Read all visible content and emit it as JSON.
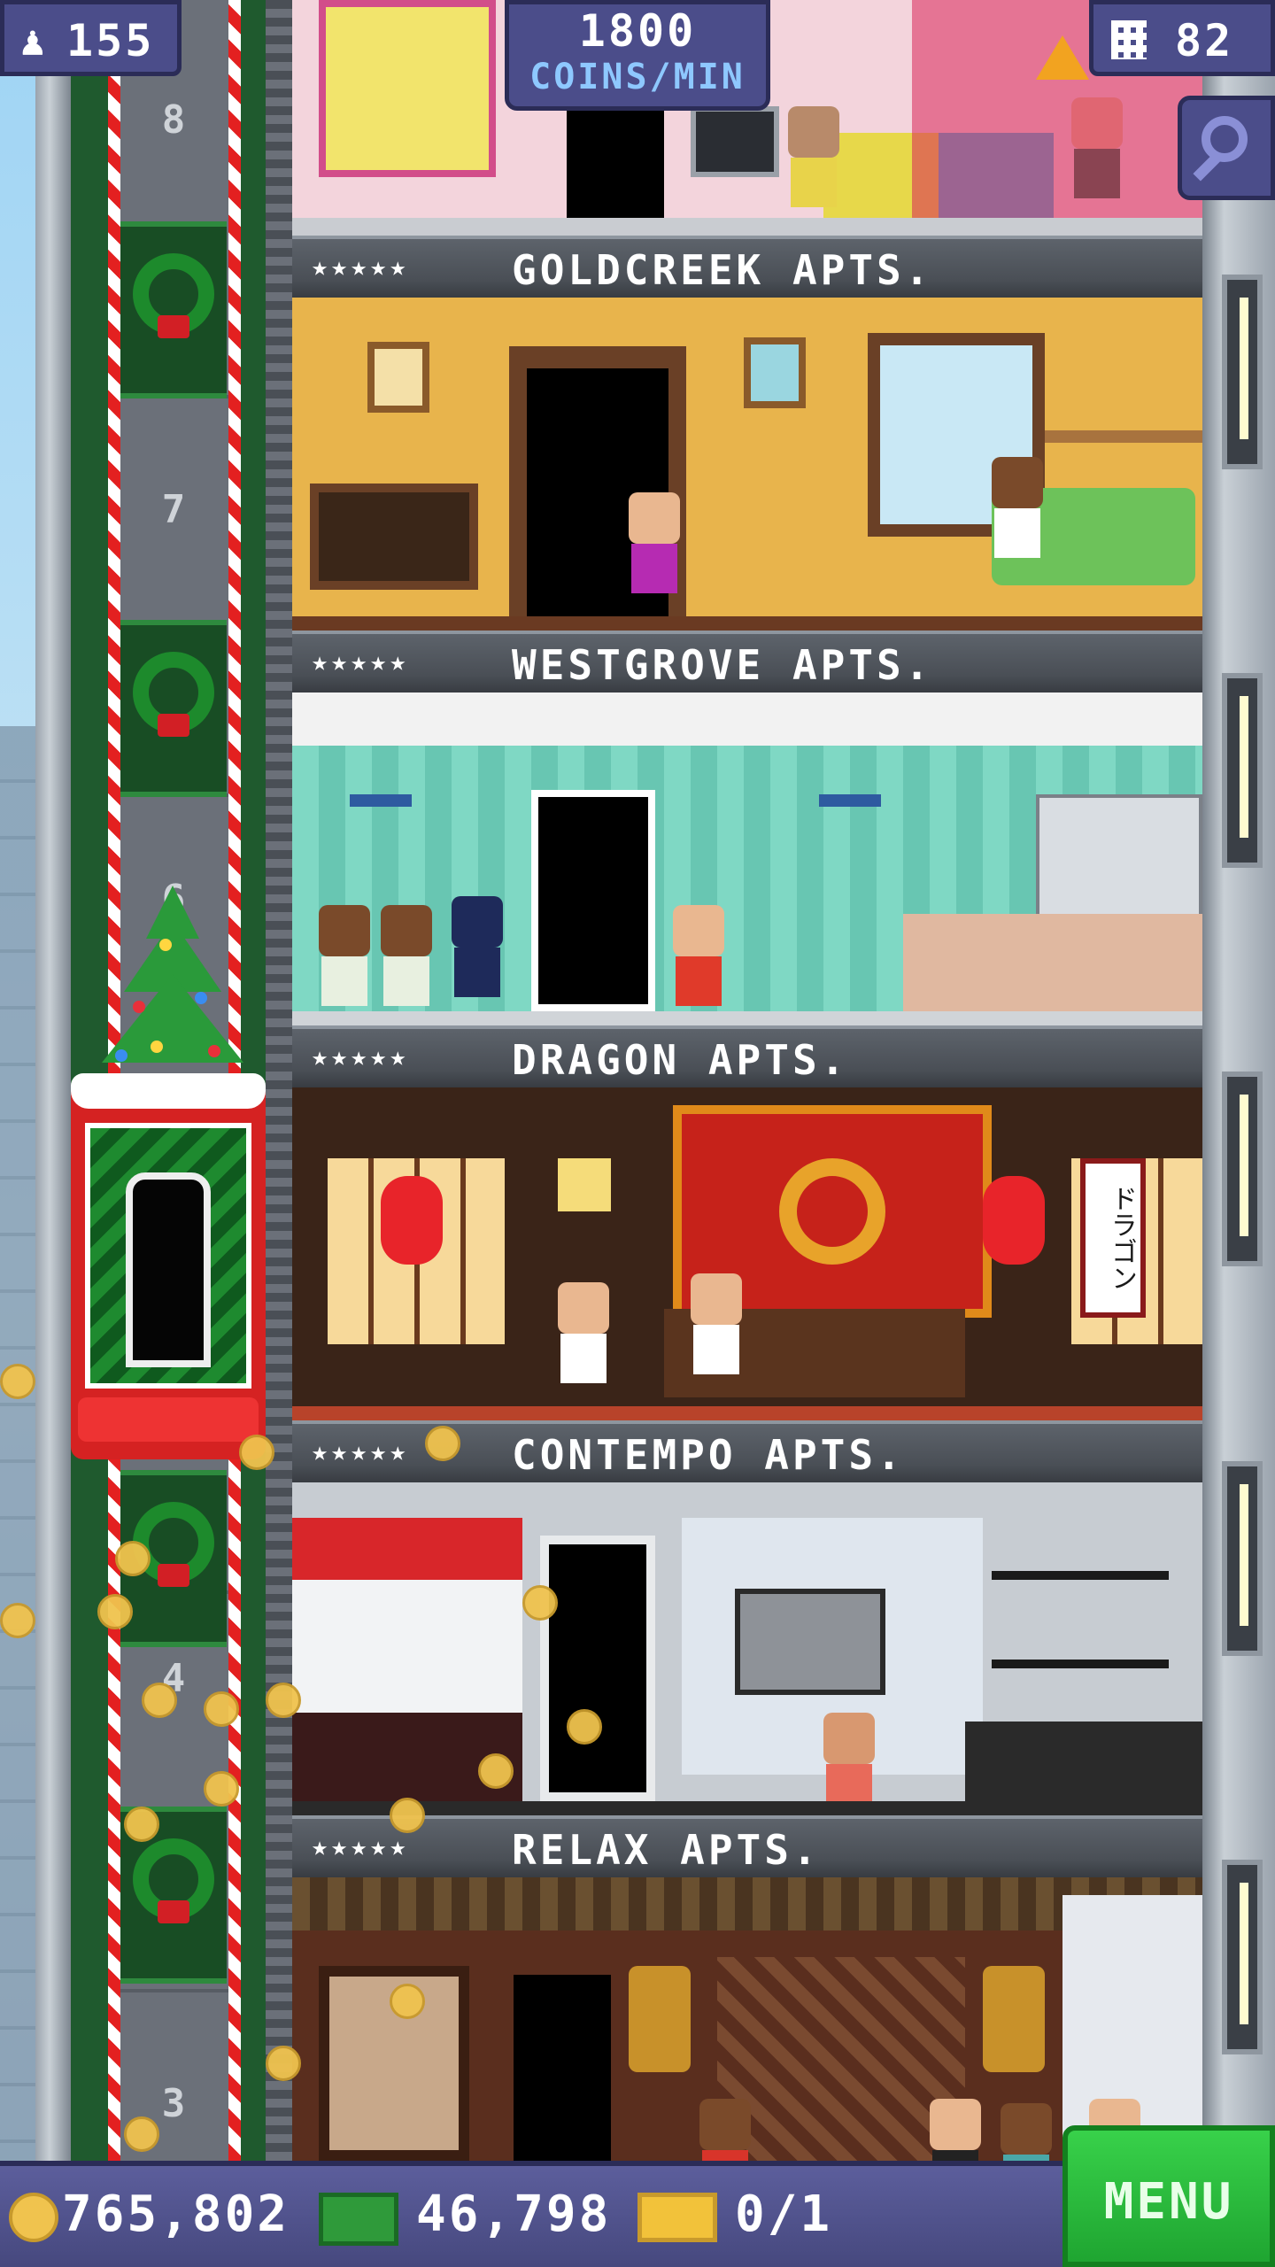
{
  "hud": {
    "population": "155",
    "coins_rate_value": "1800",
    "coins_rate_unit": "COINS/MIN",
    "floor_count": "82"
  },
  "floors": [
    {
      "stars": "★★★★★",
      "name": "GOLDCREEK APTS."
    },
    {
      "stars": "★★★★★",
      "name": "WESTGROVE APTS."
    },
    {
      "stars": "★★★★★",
      "name": "DRAGON APTS."
    },
    {
      "stars": "★★★★★",
      "name": "CONTEMPO APTS."
    },
    {
      "stars": "★★★★★",
      "name": "RELAX APTS."
    }
  ],
  "shaft_numbers": {
    "n8": "8",
    "n7": "7",
    "n6": "6",
    "n4": "4",
    "n3": "3"
  },
  "dragon_scroll": "ドラゴン",
  "bottom_bar": {
    "coins": "765,802",
    "bux": "46,798",
    "vip": "0/1",
    "menu_label": "MENU"
  },
  "colors": {
    "hud_bg": "#4b4d8a",
    "menu_green": "#1fa531",
    "coin_gold": "#f0c34e",
    "bux_green": "#2f9a3a"
  }
}
